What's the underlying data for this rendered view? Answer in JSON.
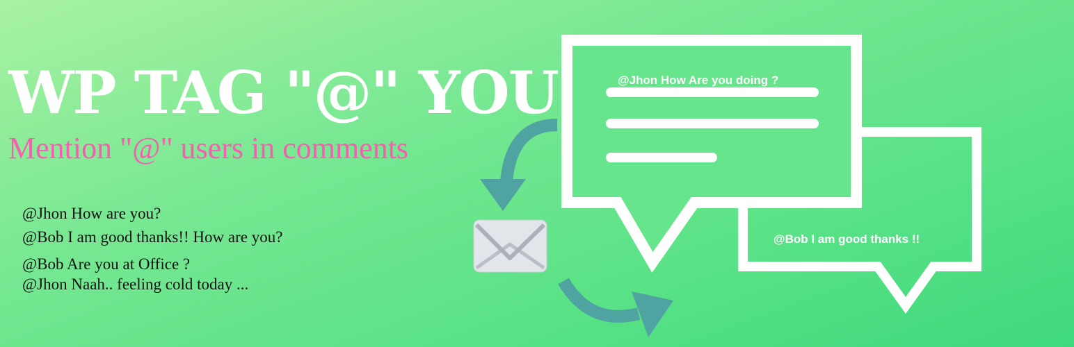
{
  "title": "WP TAG \"@\" YOU",
  "subtitle": "Mention \"@\" users in comments",
  "comments": [
    "@Jhon How are you?",
    "@Bob I am good thanks!! How are you?",
    "@Bob Are you at Office ?",
    "@Jhon Naah.. feeling cold today ..."
  ],
  "bubbles": {
    "main_text": "@Jhon  How Are you doing ?",
    "second_text": "@Bob  I am good thanks !!"
  },
  "icons": {
    "envelope": "envelope-icon",
    "arrow_down": "curved-arrow-down-icon",
    "arrow_right": "curved-arrow-right-icon"
  },
  "colors": {
    "title": "#ffffff",
    "subtitle": "#f45fb0",
    "arrow": "#4fa3a0",
    "envelope": "#e2e6eb"
  }
}
